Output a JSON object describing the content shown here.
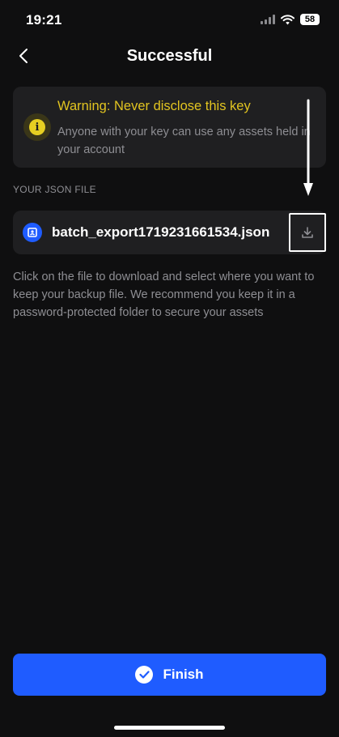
{
  "status_bar": {
    "time": "19:21",
    "battery": "58"
  },
  "nav": {
    "title": "Successful",
    "back_icon": "chevron-left-icon"
  },
  "warning": {
    "title": "Warning: Never disclose this key",
    "body": "Anyone with your key can use any assets held in your account",
    "icon": "info-icon",
    "accent_color": "#e2c420"
  },
  "json_section": {
    "label": "YOUR JSON FILE",
    "file_name": "batch_export1719231661534.json",
    "file_icon": "wallet-file-icon",
    "download_icon": "download-icon"
  },
  "description": "Click on the file to download and select where you want to keep your backup file. We recommend you keep it in a password-protected folder to secure your assets",
  "finish_button": {
    "label": "Finish",
    "icon": "check-circle-icon",
    "color": "#1f5cff"
  }
}
